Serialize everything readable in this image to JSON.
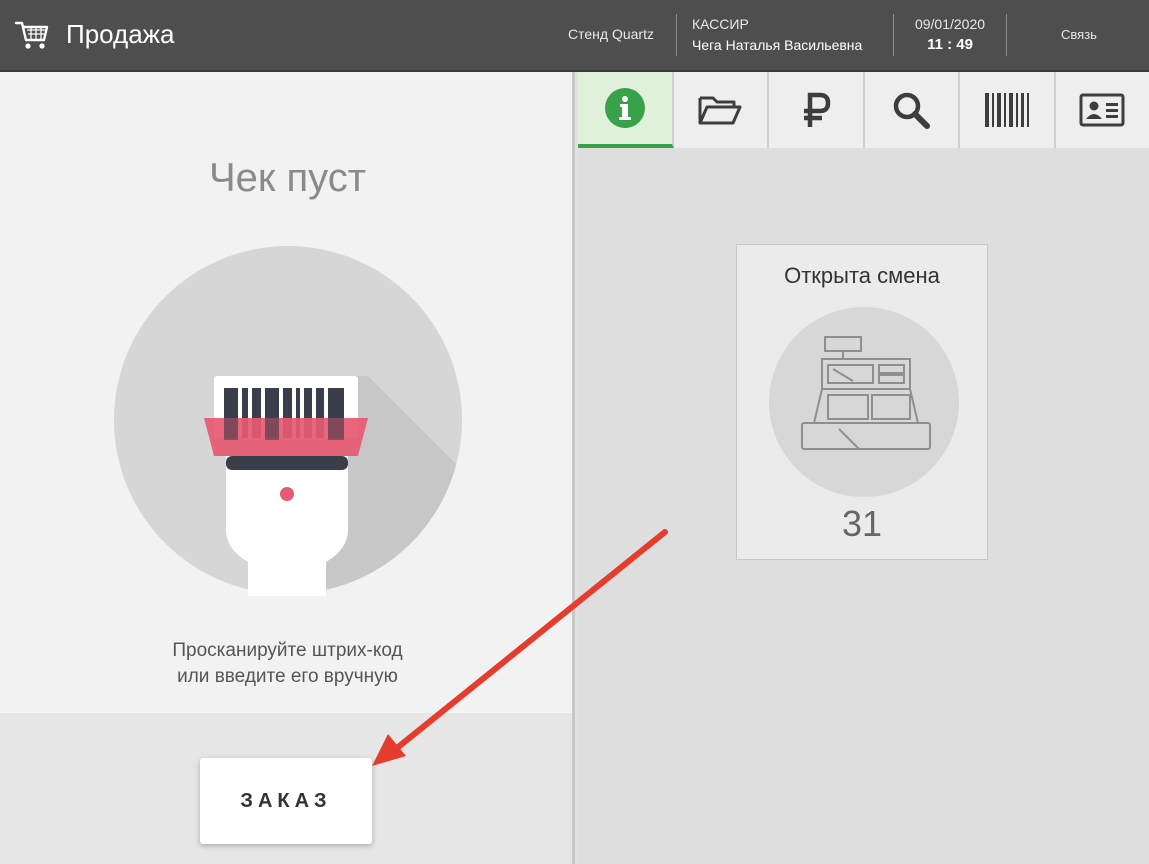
{
  "header": {
    "title": "Продажа",
    "stand": "Стенд Quartz",
    "role": "КАССИР",
    "user_name": "Чега Наталья Васильевна",
    "date": "09/01/2020",
    "time": "11 : 49",
    "link_label": "Связь",
    "icon": "cart-icon"
  },
  "receipt": {
    "empty_title": "Чек пуст",
    "hint_line1": "Просканируйте штрих-код",
    "hint_line2": "или введите его вручную",
    "order_button": "ЗАКАЗ",
    "illustration": "barcode-scanner-icon"
  },
  "tabs": [
    {
      "icon": "info-icon",
      "active": true
    },
    {
      "icon": "folder-icon",
      "active": false
    },
    {
      "icon": "ruble-icon",
      "active": false
    },
    {
      "icon": "search-icon",
      "active": false
    },
    {
      "icon": "barcode-icon",
      "active": false
    },
    {
      "icon": "id-card-icon",
      "active": false
    }
  ],
  "shift_card": {
    "title": "Открыта смена",
    "number": "31",
    "icon": "cash-register-icon"
  },
  "colors": {
    "header_bg": "#4e4e4e",
    "active_tab": "#3aa14b",
    "scanner_accent": "#e65a72",
    "annotation_arrow": "#e53c2e"
  }
}
